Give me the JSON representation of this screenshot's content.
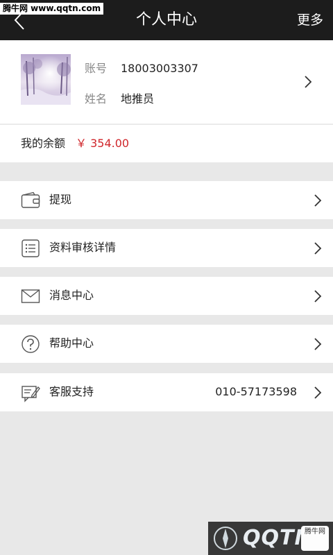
{
  "header": {
    "title": "个人中心",
    "more_label": "更多",
    "watermark": "腾牛网 www.qqtn.com"
  },
  "profile": {
    "account_label": "账号",
    "account_value": "18003003307",
    "name_label": "姓名",
    "name_value": "地推员"
  },
  "balance": {
    "label": "我的余额",
    "value": "￥ 354.00"
  },
  "menu": [
    {
      "label": "提现",
      "icon": "wallet-icon"
    },
    {
      "label": "资料审核详情",
      "icon": "list-icon"
    },
    {
      "label": "消息中心",
      "icon": "envelope-icon"
    },
    {
      "label": "帮助中心",
      "icon": "help-icon"
    },
    {
      "label": "客服支持",
      "icon": "support-icon",
      "value": "010-57173598"
    }
  ],
  "watermark_bottom": {
    "logo_text": "QQTN",
    "badge_text": "腾牛网"
  },
  "colors": {
    "topbar": "#1c1c1c",
    "accent_red": "#d0262b",
    "background": "#e8e8e8"
  }
}
